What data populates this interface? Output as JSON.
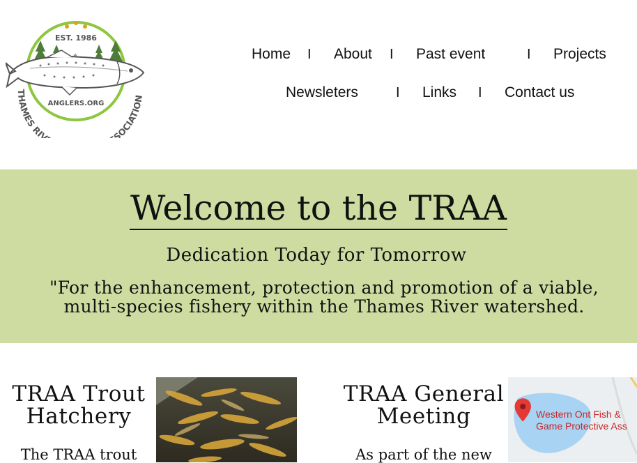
{
  "logo": {
    "established": "EST. 1986",
    "website": "ANGLERS.ORG",
    "org_name": "THAMES RIVER ANGLERS ASSOCIATION",
    "ring_color": "#8dc63f",
    "tree_color": "#4e7d3a"
  },
  "nav": {
    "items": [
      "Home",
      "About",
      "Past event",
      "Projects",
      "Newsleters",
      "Links",
      "Contact us"
    ],
    "separator": "I"
  },
  "hero": {
    "title": "Welcome to the TRAA",
    "subtitle": "Dedication Today for Tomorrow",
    "mission_line1": "\"For the enhancement, protection and promotion of a viable,",
    "mission_line2": "multi-species fishery within the Thames River watershed.",
    "background_color": "#cfdca1"
  },
  "cards": {
    "hatchery": {
      "title_line1": "TRAA Trout",
      "title_line2": "Hatchery",
      "body_start": "The TRAA trout"
    },
    "meeting": {
      "title_line1": "TRAA General",
      "title_line2": "Meeting",
      "body_start": "As part of the new",
      "map_label_line1": "Western Ont Fish &",
      "map_label_line2": "Game Protective Ass"
    }
  }
}
